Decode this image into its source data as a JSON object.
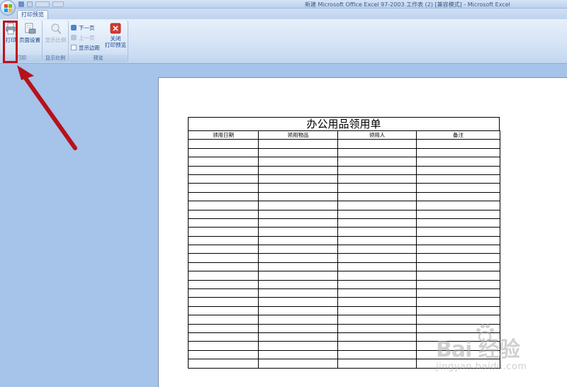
{
  "window": {
    "title": "新建 Microsoft Office Excel 97-2003 工作表 (2)  [兼容模式] - Microsoft Excel"
  },
  "ribbon": {
    "active_tab": "打印预览",
    "groups": {
      "print": {
        "label": "打印",
        "print_button": "打印",
        "page_setup_button": "页面设置"
      },
      "zoom": {
        "label": "显示比例",
        "zoom_button": "显示比例"
      },
      "preview": {
        "label": "预览",
        "next_page": "下一页",
        "prev_page": "上一页",
        "show_margins": "显示边距",
        "close_line1": "关闭",
        "close_line2": "打印预览"
      }
    }
  },
  "sheet": {
    "title": "办公用品领用单",
    "columns": [
      "领用日期",
      "领用物品",
      "领用人",
      "备注"
    ],
    "empty_row_count": 26
  },
  "watermark": {
    "main": "Bai  经验",
    "sub": "jingyan.baidu.com"
  },
  "colors": {
    "ribbon_text": "#15428b",
    "highlight": "#c0101a",
    "preview_background": "#a6c3ea"
  }
}
